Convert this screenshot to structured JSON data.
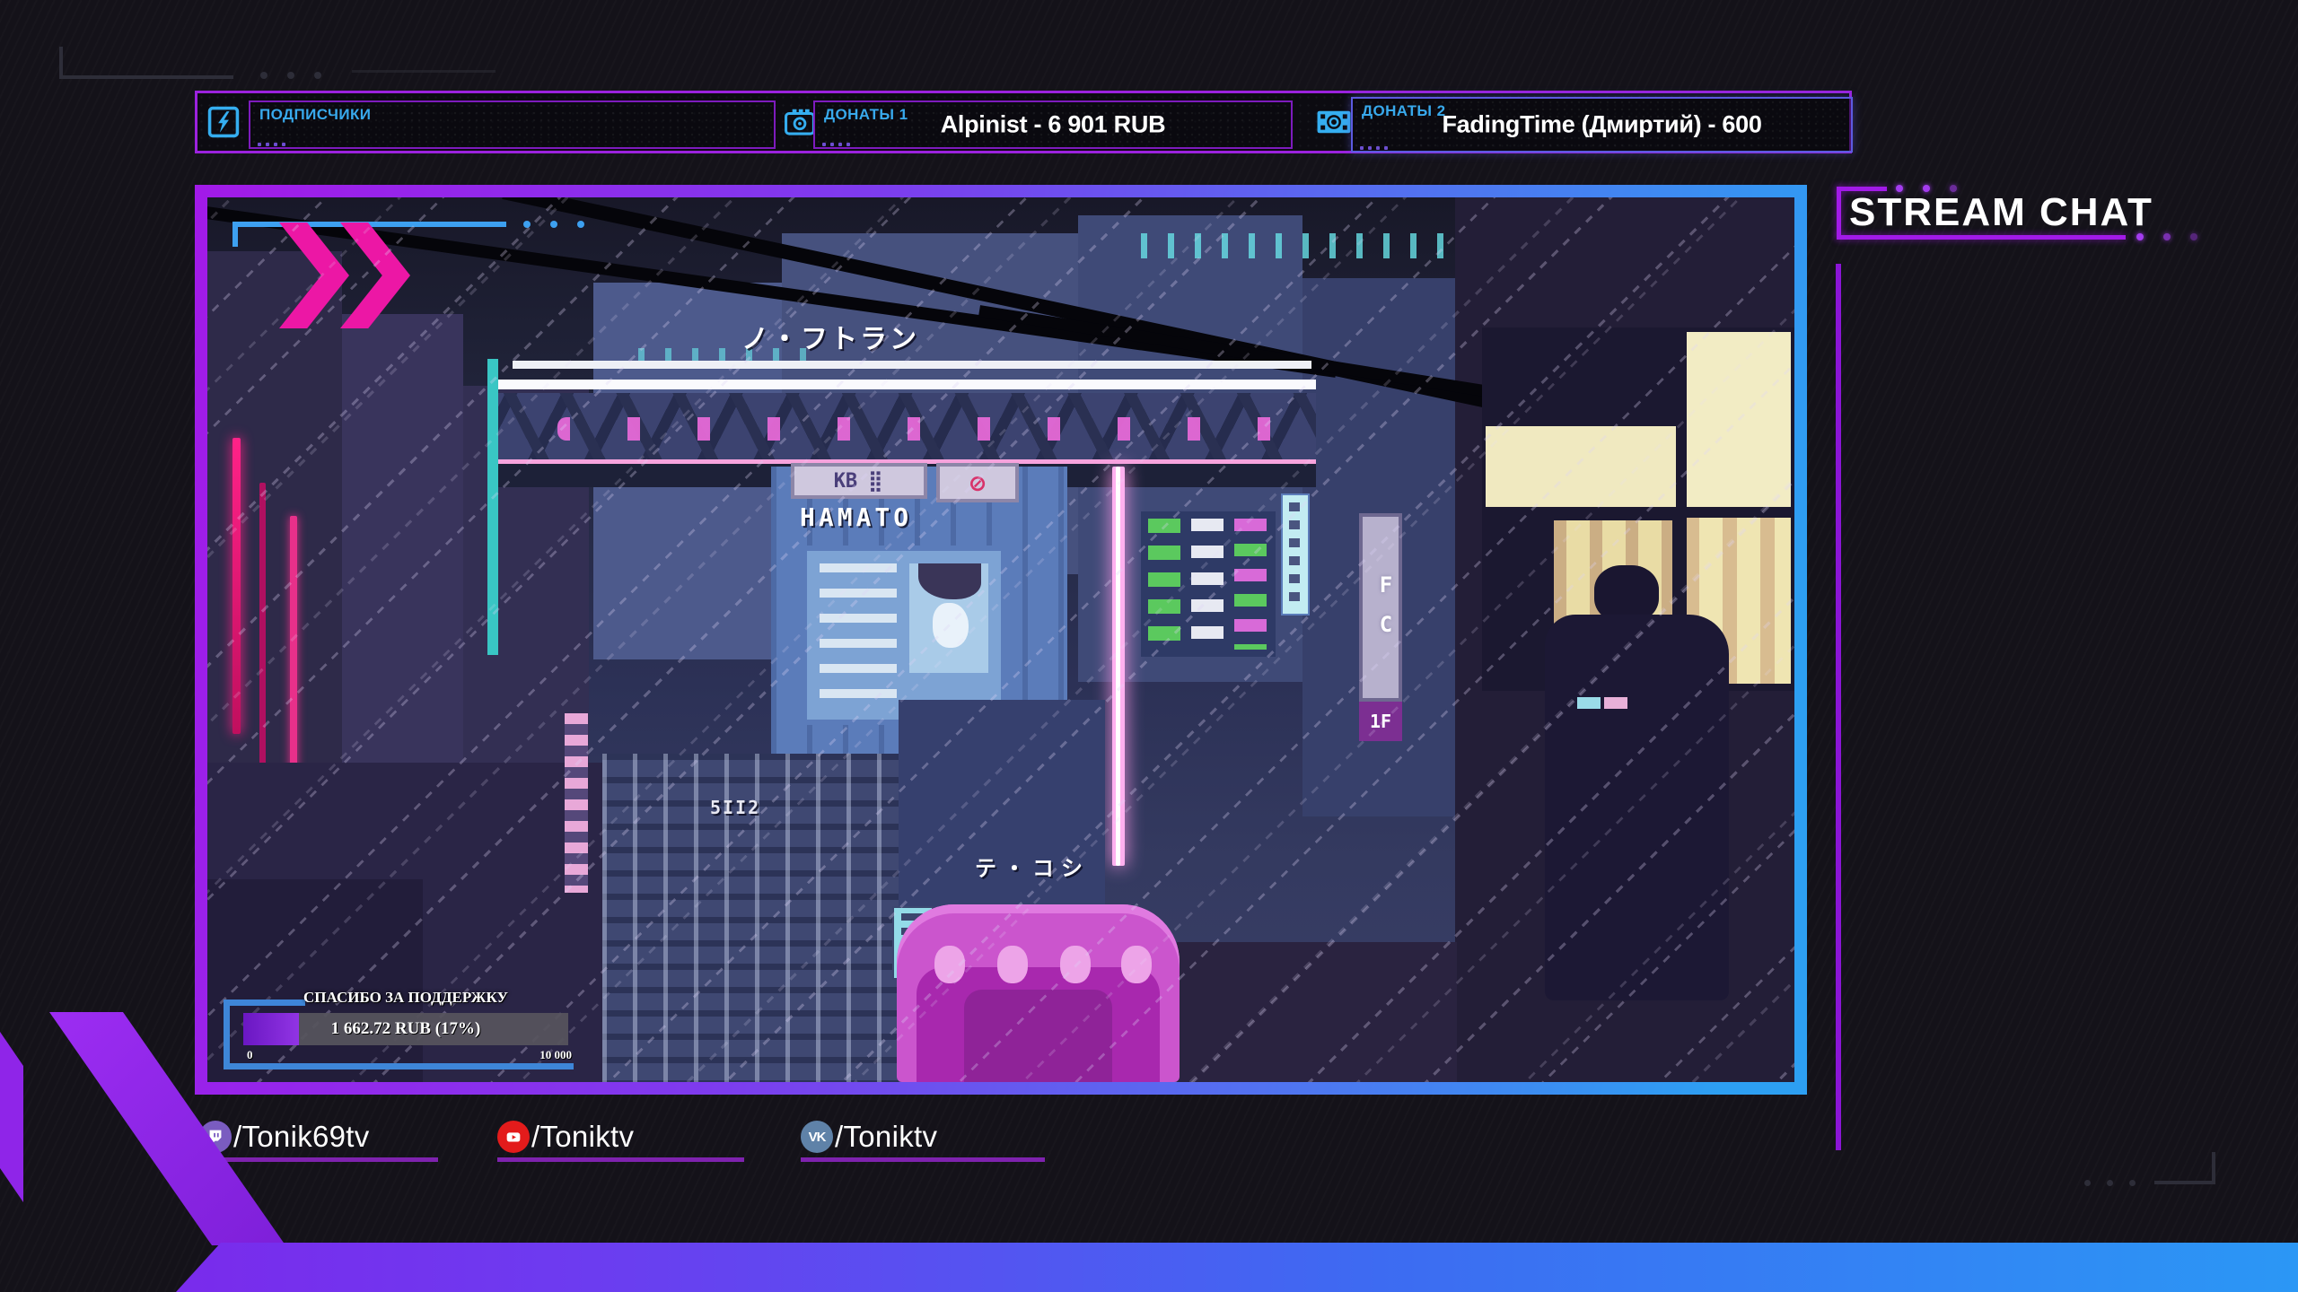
{
  "topbar": {
    "subscribers": {
      "label": "ПОДПИСЧИКИ"
    },
    "donations1": {
      "label": "ДОНАТЫ 1",
      "value": "Alpinist - 6 901 RUB"
    },
    "donations2": {
      "label": "ДОНАТЫ 2",
      "value": "FadingTime (Дмиртий) - 600"
    }
  },
  "chat": {
    "title": "STREAM CHAT"
  },
  "goal": {
    "title": "СПАСИБО ЗА ПОДДЕРЖКУ",
    "value": "1 662.72 RUB (17%)",
    "percent": 17,
    "scale_min": "0",
    "scale_max": "10 000"
  },
  "art_signs": {
    "top_kana": "ノ・フトラン",
    "hamato": "HAMATO",
    "kb": "КВ",
    "no_entry": "⊘",
    "fc": "FC",
    "one_f": "1F",
    "digits": "5II2",
    "bottom_kana": "テ・コシ"
  },
  "social": {
    "twitch": {
      "handle": "/Tonik69tv"
    },
    "youtube": {
      "handle": "/Toniktv"
    },
    "vk": {
      "handle": "/Toniktv",
      "icon_text": "VK"
    }
  },
  "colors": {
    "accent_cyan": "#35aef0",
    "topbar_border": "#9b22dd",
    "donations2_border": "#5d5ae0",
    "chat_accent": "#a21ae8",
    "frame_gradient_from": "#a21ae8",
    "frame_gradient_to": "#2d9ff2",
    "footer_gradient_from": "#7f24ea",
    "footer_gradient_to": "#2b97f5",
    "goal_bracket": "#3e86d8",
    "goal_fill": "#9134e4",
    "twitch": "#7a5cc0",
    "youtube": "#e31b1b",
    "vk": "#5f82a8",
    "underline": "#7e22ae"
  }
}
